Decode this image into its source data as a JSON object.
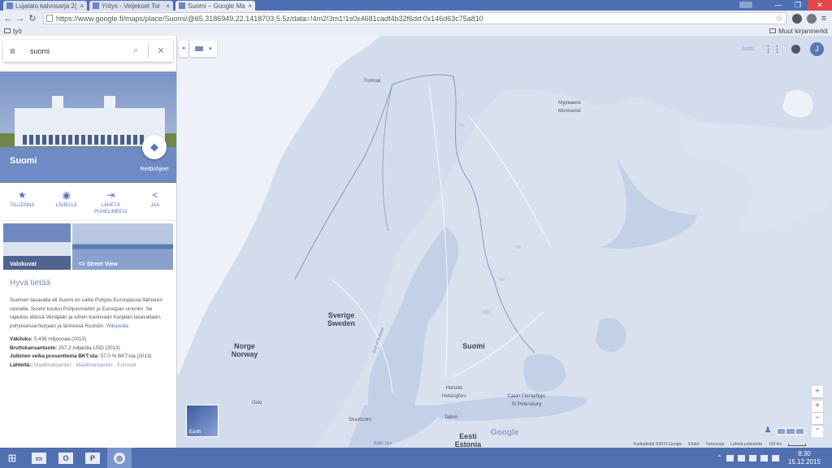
{
  "browser": {
    "tabs": [
      {
        "title": "Lujatalo kalvosarja 2(",
        "close": "×"
      },
      {
        "title": "Yritys - Veljekset Toi",
        "close": "×"
      },
      {
        "title": "Suomi – Google Map",
        "close": "×",
        "active": true
      }
    ],
    "window_buttons": {
      "minimize": "—",
      "restore": "❐",
      "close": "✕"
    },
    "url": "https://www.google.fi/maps/place/Suomi/@65.3186949,22.1418703,5.5z/data=!4m2!3m1!1s0x4681cadf4b32f6dd:0x146d63c75a810",
    "bookmarks": {
      "left": "työ",
      "right": "Muut kirjanmerkit"
    }
  },
  "search": {
    "query": "suomi"
  },
  "place": {
    "title": "Suomi",
    "directions_label": "Reittiohjeet",
    "actions": [
      {
        "icon": "★",
        "label": "TALLENNA"
      },
      {
        "icon": "◉",
        "label": "LÄHELLÄ"
      },
      {
        "icon": "⇥",
        "label": "LÄHETÄ PUHELIMEESI"
      },
      {
        "icon": "<",
        "label": "JAA"
      }
    ],
    "photos": [
      {
        "label": "Valokuvat"
      },
      {
        "label": "<> Street View"
      }
    ],
    "about": {
      "heading": "Hyvä tietää",
      "description": "Suomen tasavalta eli Suomi on valtio Pohjois-Euroopassa Itämeren rannalla. Suomi kuuluu Pohjoismaihin ja Euroopan unioniin. Se rajautuu idässä Venäjään ja siihen kuuluvaan Karjalan tasavaltaan, pohjoisessa Norjaan ja lännessä Ruotsiin.",
      "wiki_link": "Wikipedia",
      "facts": [
        {
          "key": "Väkiluku:",
          "value": "5,439 miljoonaa (2013)"
        },
        {
          "key": "Bruttokansantuote:",
          "value": "267,3 miljardia USD (2013)"
        },
        {
          "key": "Julkinen velka prosentteina BKT:sta:",
          "value": "57,0 % BKT:sta (2013)"
        },
        {
          "key": "Lähteitä::",
          "value": "Maailmanpankki · Maailmanpankki · Eurostat"
        }
      ]
    }
  },
  "map": {
    "user": "Jussi",
    "avatar_letter": "J",
    "earth_label": "Earth",
    "labels": {
      "norge": "Norge\nNorway",
      "sverige": "Sverige\nSweden",
      "suomi": "Suomi",
      "eesti": "Eesti\nEstonia",
      "tromso": "Tromsø",
      "murmansk": "Мурманск\nMurmansk",
      "helsinki": "Helsinki\nHelsingfors",
      "stpete": "Санкт-Петербург\nSt Petersburg",
      "tallinn": "Tallinn",
      "stockholm": "Stockholm",
      "oslo": "Oslo",
      "bothnia": "Gulf of Bothnia",
      "baltic": "Baltic Sea"
    },
    "google_logo": "Google",
    "attribution": [
      "Karttatiedot ©2015 Google",
      "Ehdot",
      "Tietosuoja",
      "Lähetä palautetta",
      "100 km"
    ],
    "zoom": {
      "locate": "⌖",
      "plus": "+",
      "minus": "−"
    }
  },
  "taskbar": {
    "time": "8:30",
    "date": "15.12.2015"
  }
}
